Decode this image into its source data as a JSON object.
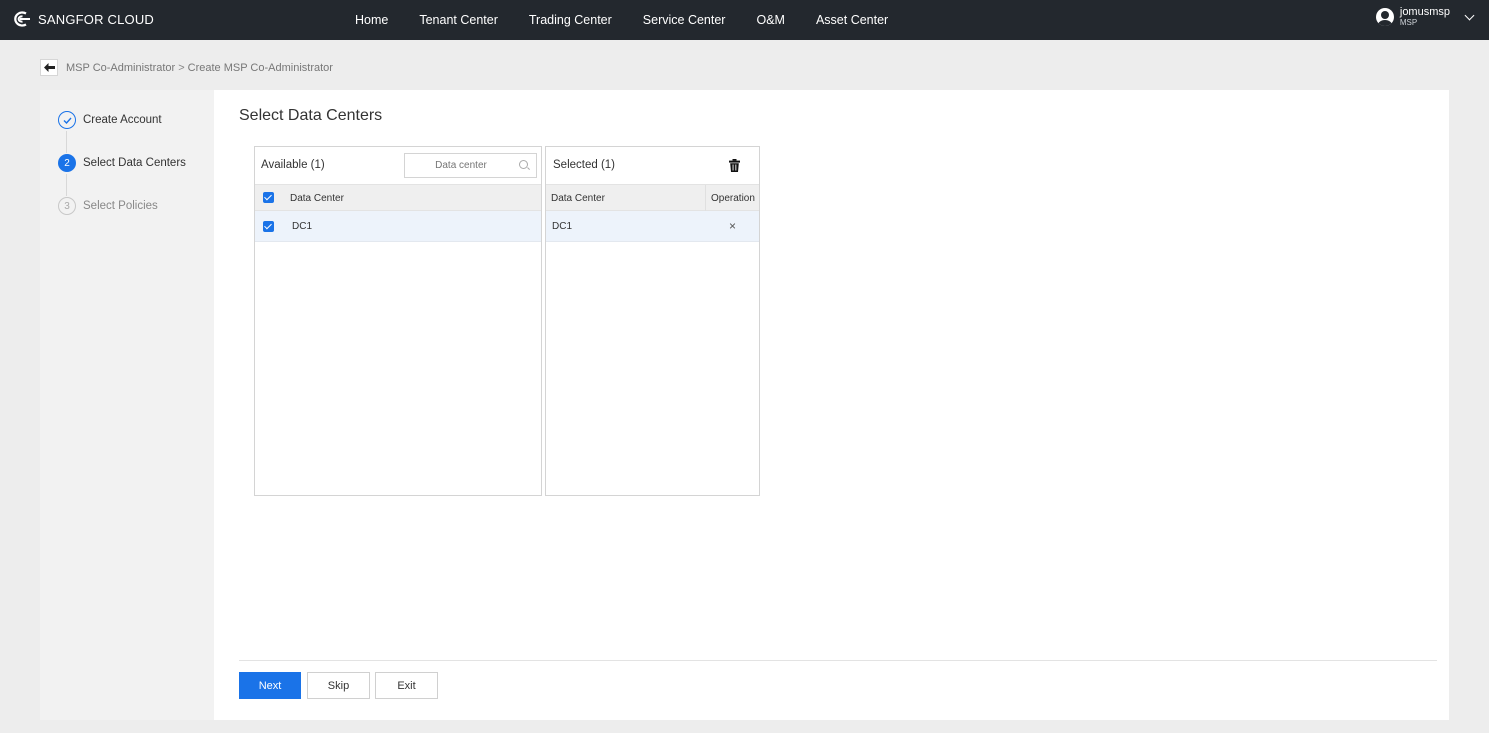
{
  "header": {
    "brand": "SANGFOR CLOUD",
    "nav": [
      "Home",
      "Tenant Center",
      "Trading Center",
      "Service Center",
      "O&M",
      "Asset Center"
    ],
    "user": {
      "name": "jomusmsp",
      "role": "MSP"
    }
  },
  "breadcrumb": {
    "parent": "MSP Co-Administrator",
    "separator": ">",
    "current": "Create MSP Co-Administrator"
  },
  "steps": [
    {
      "number": "",
      "label": "Create Account",
      "status": "done"
    },
    {
      "number": "2",
      "label": "Select Data Centers",
      "status": "active"
    },
    {
      "number": "3",
      "label": "Select Policies",
      "status": "todo"
    }
  ],
  "section_title": "Select Data Centers",
  "available": {
    "title": "Available (1)",
    "search_placeholder": "Data center",
    "column": "Data Center",
    "rows": [
      {
        "name": "DC1",
        "checked": true
      }
    ]
  },
  "selected": {
    "title": "Selected (1)",
    "columns": [
      "Data Center",
      "Operation"
    ],
    "rows": [
      {
        "name": "DC1",
        "remove": "×"
      }
    ]
  },
  "buttons": {
    "next": "Next",
    "skip": "Skip",
    "exit": "Exit"
  },
  "colors": {
    "accent": "#1a73e8",
    "topbar": "#23282e",
    "row_selected": "#edf3fb"
  }
}
